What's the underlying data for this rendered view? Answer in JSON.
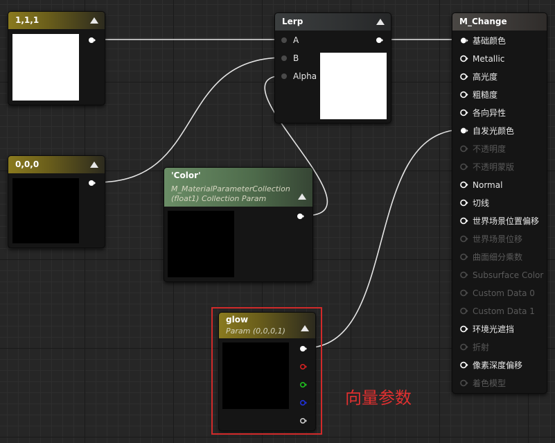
{
  "nodes": {
    "const_white": {
      "title": "1,1,1"
    },
    "const_black": {
      "title": "0,0,0"
    },
    "lerp": {
      "title": "Lerp",
      "pins": [
        "A",
        "B",
        "Alpha"
      ]
    },
    "color_param": {
      "title": "'Color'",
      "subtitle_line1": "M_MaterialParameterCollection",
      "subtitle_line2": "(float1) Collection Param"
    },
    "glow": {
      "title": "glow",
      "subtitle": "Param (0,0,0,1)"
    },
    "material": {
      "title": "M_Change",
      "pins": [
        {
          "label": "基础颜色",
          "enabled": true,
          "connected": true
        },
        {
          "label": "Metallic",
          "enabled": true,
          "connected": false
        },
        {
          "label": "高光度",
          "enabled": true,
          "connected": false
        },
        {
          "label": "粗糙度",
          "enabled": true,
          "connected": false
        },
        {
          "label": "各向异性",
          "enabled": true,
          "connected": false
        },
        {
          "label": "自发光颜色",
          "enabled": true,
          "connected": true
        },
        {
          "label": "不透明度",
          "enabled": false,
          "connected": false
        },
        {
          "label": "不透明蒙版",
          "enabled": false,
          "connected": false
        },
        {
          "label": "Normal",
          "enabled": true,
          "connected": false
        },
        {
          "label": "切线",
          "enabled": true,
          "connected": false
        },
        {
          "label": "世界场景位置偏移",
          "enabled": true,
          "connected": false
        },
        {
          "label": "世界场景位移",
          "enabled": false,
          "connected": false
        },
        {
          "label": "曲面细分乘数",
          "enabled": false,
          "connected": false
        },
        {
          "label": "Subsurface Color",
          "enabled": false,
          "connected": false
        },
        {
          "label": "Custom Data 0",
          "enabled": false,
          "connected": false
        },
        {
          "label": "Custom Data 1",
          "enabled": false,
          "connected": false
        },
        {
          "label": "环境光遮挡",
          "enabled": true,
          "connected": false
        },
        {
          "label": "折射",
          "enabled": false,
          "connected": false
        },
        {
          "label": "像素深度偏移",
          "enabled": true,
          "connected": false
        },
        {
          "label": "着色模型",
          "enabled": false,
          "connected": false
        }
      ]
    }
  },
  "annotation": {
    "text": "向量参数"
  },
  "colors": {
    "wire": "#e6e6e6",
    "annotation": "#d22a2a",
    "pin_red": "#d42222",
    "pin_green": "#20c020",
    "pin_blue": "#2030d8"
  }
}
